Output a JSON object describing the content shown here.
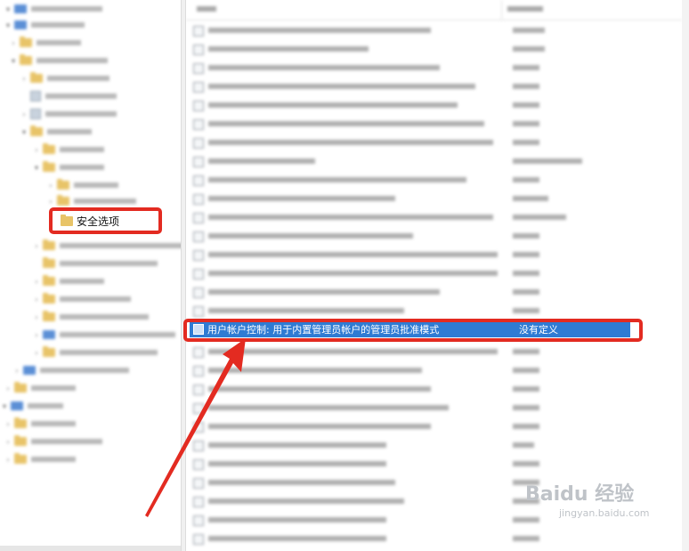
{
  "tree": {
    "highlighted_item": "安全选项"
  },
  "list": {
    "selected_row": {
      "policy": "用户帐户控制: 用于内置管理员帐户的管理员批准模式",
      "setting": "没有定义"
    }
  },
  "watermark": {
    "brand": "Baidu 经验",
    "sub": "jingyan.baidu.com"
  },
  "colors": {
    "annotation_red": "#e32b21",
    "selection_blue": "#2f7bd3",
    "folder_yellow": "#e8c468"
  },
  "icons": {
    "folder": "folder-icon",
    "policy": "policy-icon",
    "arrow": "red-pointer-arrow"
  }
}
